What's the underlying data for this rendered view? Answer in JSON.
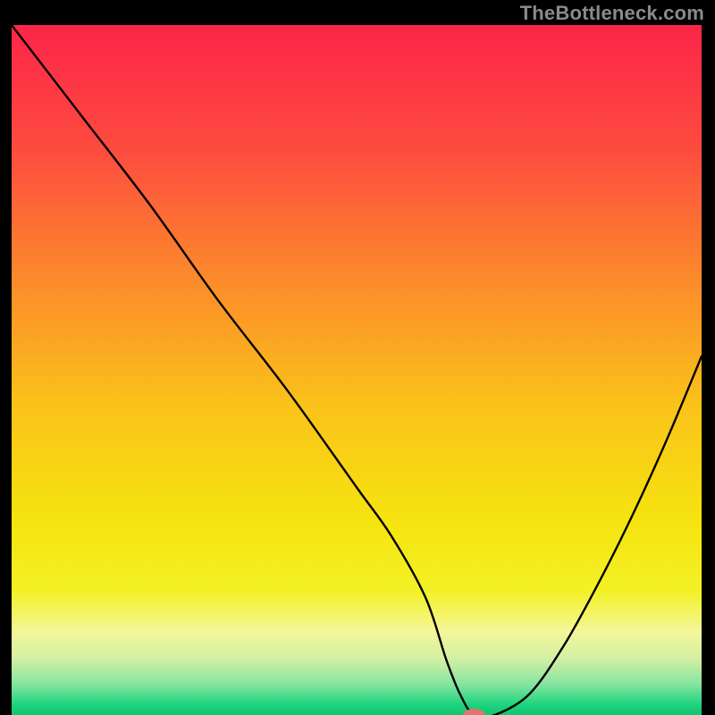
{
  "watermark": "TheBottleneck.com",
  "colors": {
    "frame": "#000000",
    "curve": "#000000",
    "marker": "#e2746e",
    "gradient_stops": [
      {
        "offset": 0.0,
        "color": "#fd2549"
      },
      {
        "offset": 0.18,
        "color": "#fd4b3f"
      },
      {
        "offset": 0.38,
        "color": "#fc8e2a"
      },
      {
        "offset": 0.55,
        "color": "#fac21a"
      },
      {
        "offset": 0.72,
        "color": "#f5e40f"
      },
      {
        "offset": 0.82,
        "color": "#f3f126"
      },
      {
        "offset": 0.88,
        "color": "#f4f69a"
      },
      {
        "offset": 0.92,
        "color": "#d0f0a4"
      },
      {
        "offset": 0.955,
        "color": "#87e4a0"
      },
      {
        "offset": 0.985,
        "color": "#1ed47e"
      },
      {
        "offset": 1.0,
        "color": "#14c26f"
      }
    ]
  },
  "chart_data": {
    "type": "line",
    "title": "",
    "xlabel": "",
    "ylabel": "",
    "xlim": [
      0,
      100
    ],
    "ylim": [
      0,
      100
    ],
    "series": [
      {
        "name": "curve",
        "x": [
          0,
          10,
          20,
          30,
          40,
          50,
          55,
          60,
          63,
          65,
          67,
          70,
          75,
          80,
          85,
          90,
          95,
          100
        ],
        "y": [
          100,
          87,
          74,
          60,
          47,
          33,
          26,
          17,
          8,
          3,
          0,
          0,
          3,
          10,
          19,
          29,
          40,
          52
        ]
      }
    ],
    "marker": {
      "name": "optimal-point",
      "x": 67,
      "y": 0,
      "rx": 1.6,
      "ry": 0.9
    }
  }
}
